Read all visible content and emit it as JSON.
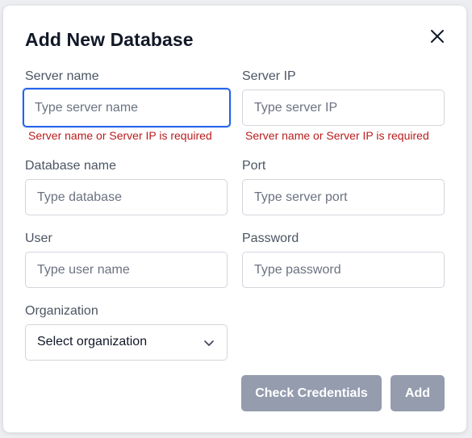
{
  "modal": {
    "title": "Add New Database",
    "close_icon": "close-icon"
  },
  "fields": {
    "server_name": {
      "label": "Server name",
      "placeholder": "Type server name",
      "value": "",
      "error": "Server name or Server IP is required"
    },
    "server_ip": {
      "label": "Server IP",
      "placeholder": "Type server IP",
      "value": "",
      "error": "Server name or Server IP is required"
    },
    "database_name": {
      "label": "Database name",
      "placeholder": "Type database",
      "value": ""
    },
    "port": {
      "label": "Port",
      "placeholder": "Type server port",
      "value": ""
    },
    "user": {
      "label": "User",
      "placeholder": "Type user name",
      "value": ""
    },
    "password": {
      "label": "Password",
      "placeholder": "Type password",
      "value": ""
    },
    "organization": {
      "label": "Organization",
      "selected": "Select organization",
      "icon": "chevron-down-icon"
    }
  },
  "buttons": {
    "check_credentials": "Check Credentials",
    "add": "Add"
  },
  "colors": {
    "focus_border": "#2563eb",
    "error_text": "#b91c1c",
    "button_bg": "#949cae"
  }
}
